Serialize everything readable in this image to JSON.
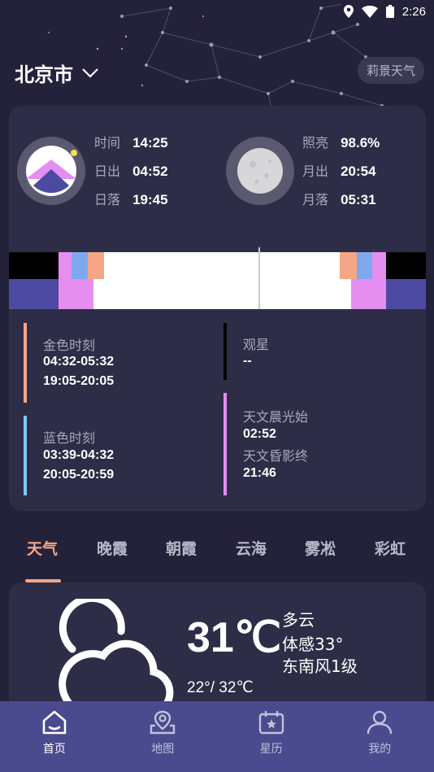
{
  "status_bar": {
    "time": "2:26"
  },
  "header": {
    "city": "北京市",
    "app_name": "莉景天气"
  },
  "sun": {
    "time_label": "时间",
    "time_value": "14:25",
    "sunrise_label": "日出",
    "sunrise_value": "04:52",
    "sunset_label": "日落",
    "sunset_value": "19:45"
  },
  "moon": {
    "illum_label": "照亮",
    "illum_value": "98.6%",
    "moonrise_label": "月出",
    "moonrise_value": "20:54",
    "moonset_label": "月落",
    "moonset_value": "05:31"
  },
  "periods": {
    "golden": {
      "title": "金色时刻",
      "line1": "04:32-05:32",
      "line2": "19:05-20:05",
      "color": "#f5a785"
    },
    "stargazing": {
      "title": "观星",
      "value": "--",
      "color": "#000000"
    },
    "blue": {
      "title": "蓝色时刻",
      "line1": "03:39-04:32",
      "line2": "20:05-20:59",
      "color": "#7fc8ff"
    },
    "astro": {
      "title1": "天文晨光始",
      "value1": "02:52",
      "title2": "天文昏影终",
      "value2": "21:46",
      "color": "#e58ef0"
    }
  },
  "tabs": [
    "天气",
    "晚霞",
    "朝霞",
    "云海",
    "雾凇",
    "彩虹"
  ],
  "weather": {
    "temp": "31℃",
    "condition": "多云",
    "feels_like": "体感33°",
    "wind": "东南风1级",
    "range": "22°/ 32℃"
  },
  "nav": {
    "home": "首页",
    "map": "地图",
    "calendar": "星历",
    "mine": "我的"
  }
}
